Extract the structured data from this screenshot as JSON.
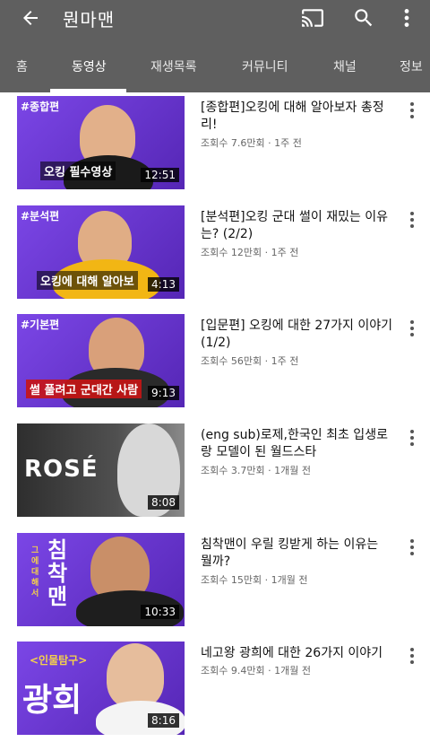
{
  "header": {
    "channel_title": "뭔마맨"
  },
  "tabs": [
    {
      "label": "홈"
    },
    {
      "label": "동영상"
    },
    {
      "label": "재생목록"
    },
    {
      "label": "커뮤니티"
    },
    {
      "label": "채널"
    },
    {
      "label": "정보"
    }
  ],
  "videos": [
    {
      "thumb_tag": "#종합편",
      "thumb_caption": "오킹 필수영상",
      "duration": "12:51",
      "title": "[종합편]오킹에 대해 알아보자 총정리!",
      "meta": "조회수 7.6만회 · 1주 전",
      "color": "#6a3bd1"
    },
    {
      "thumb_tag": "#분석편",
      "thumb_caption": "오킹에 대해 알아보",
      "duration": "4:13",
      "title": "[분석편]오킹 군대 썰이 재밌는 이유는? (2/2)",
      "meta": "조회수 12만회 · 1주 전",
      "color": "#6a3bd1"
    },
    {
      "thumb_tag": "#기본편",
      "thumb_caption": "썰 풀려고 군대간 사람",
      "duration": "9:13",
      "title": "[입문편] 오킹에 대한 27가지 이야기 (1/2)",
      "meta": "조회수 56만회 · 1주 전",
      "color": "#6a3bd1"
    },
    {
      "thumb_text": "ROSÉ",
      "duration": "8:08",
      "title": "(eng sub)로제,한국인 최초 입생로랑 모델이 된 월드스타",
      "meta": "조회수 3.7만회 · 1개월 전",
      "color": "#3a3a3a"
    },
    {
      "thumb_big": "침착맨",
      "thumb_small": "그에 대해서",
      "duration": "10:33",
      "title": "침착맨이 우릴 킹받게 하는 이유는 뭘까?",
      "meta": "조회수 15만회 · 1개월 전",
      "color": "#6a3bd1"
    },
    {
      "thumb_tag": "<인물탐구>",
      "thumb_big": "광희",
      "duration": "8:16",
      "title": "네고왕 광희에 대한 26가지 이야기",
      "meta": "조회수 9.4만회 · 1개월 전",
      "color": "#6a3bd1"
    }
  ],
  "colors": {
    "header_bg": "#5f5f5f",
    "thumb_purple": "#6a3bd1",
    "meta_gray": "#666666"
  }
}
